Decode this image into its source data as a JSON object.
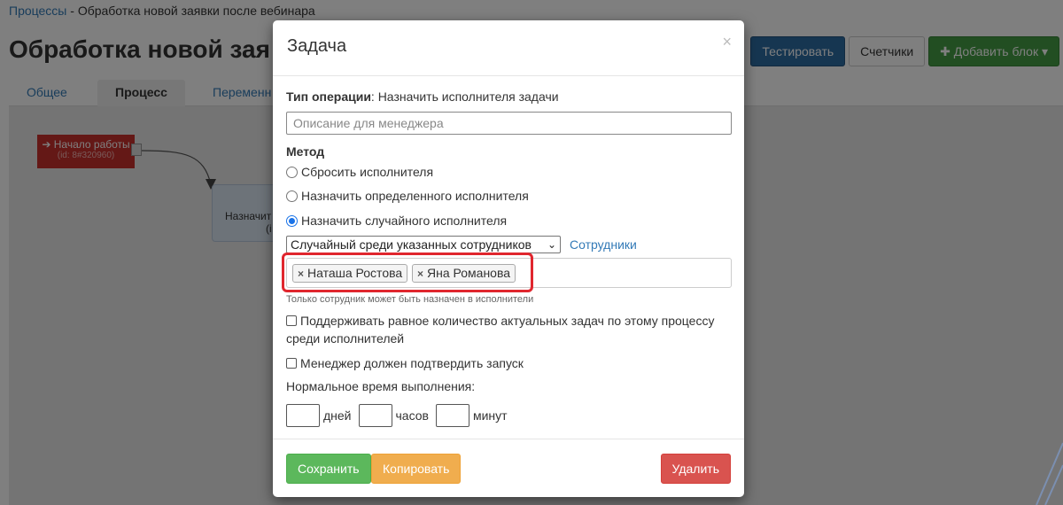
{
  "breadcrumb": {
    "root": "Процессы",
    "separator": " - ",
    "current": "Обработка новой заявки после вебинара"
  },
  "page_title": "Обработка новой зая",
  "tabs": [
    {
      "label": "Общее",
      "active": false
    },
    {
      "label": "Процесс",
      "active": true
    },
    {
      "label": "Переменн",
      "active": false
    }
  ],
  "toolbar": {
    "test_label": "Тестировать",
    "counters_label": "Счетчики",
    "add_block_label": "Добавить блок",
    "add_block_icon": "plus-icon"
  },
  "canvas": {
    "start_node": {
      "label": "Начало работы",
      "sub": "(id: 8#320960)"
    },
    "task_node": {
      "label": "Назначит",
      "sub": "(i"
    }
  },
  "modal": {
    "title": "Задача",
    "close_glyph": "×",
    "operation_type_label": "Тип операции",
    "operation_type_value": ": Назначить исполнителя задачи",
    "description_placeholder": "Описание для менеджера",
    "method_label": "Метод",
    "methods": [
      {
        "label": "Сбросить исполнителя",
        "checked": false
      },
      {
        "label": "Назначить определенного исполнителя",
        "checked": false
      },
      {
        "label": "Назначить случайного исполнителя",
        "checked": true
      }
    ],
    "random_select_value": "Случайный среди указанных сотрудников",
    "employees_link": "Сотрудники",
    "selected_employees": [
      "Наташа Ростова",
      "Яна Романова"
    ],
    "tag_remove_glyph": "×",
    "help_text": "Только сотрудник может быть назначен в исполнители",
    "checkbox_balance_label": "Поддерживать равное количество актуальных задач по этому процессу среди исполнителей",
    "checkbox_balance_checked": false,
    "checkbox_confirm_label": "Менеджер должен подтвердить запуск",
    "checkbox_confirm_checked": false,
    "normal_time_label": "Нормальное время выполнения:",
    "time_units": {
      "days": "дней",
      "hours": "часов",
      "minutes": "минут"
    },
    "buttons": {
      "save": "Сохранить",
      "copy": "Копировать",
      "delete": "Удалить"
    }
  },
  "colors": {
    "highlight": "#e0262e",
    "save": "#5cb85c",
    "copy": "#f0ad4e",
    "delete": "#d9534f",
    "primary": "#2d6ca2",
    "success": "#449d44"
  }
}
